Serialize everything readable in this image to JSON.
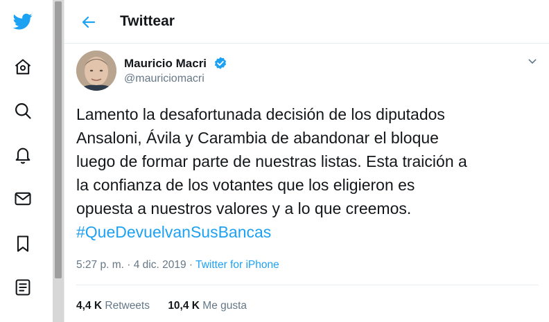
{
  "sidebar": {
    "items": [
      {
        "icon": "twitter-bird-icon"
      },
      {
        "icon": "home-icon"
      },
      {
        "icon": "search-icon"
      },
      {
        "icon": "bell-icon"
      },
      {
        "icon": "mail-icon"
      },
      {
        "icon": "bookmark-icon"
      },
      {
        "icon": "list-icon"
      }
    ]
  },
  "header": {
    "title": "Twittear",
    "back_icon": "arrow-left-icon"
  },
  "tweet": {
    "author_name": "Mauricio Macri",
    "author_handle": "@mauriciomacri",
    "verified": true,
    "text_lines": [
      "Lamento la desafortunada decisión de los diputados",
      "Ansaloni, Ávila y Carambia de abandonar el bloque",
      "luego de formar parte de nuestras listas. Esta traición a",
      "la confianza de los votantes que los eligieron es",
      "opuesta a nuestros valores y a lo que creemos."
    ],
    "hashtag": "#QueDevuelvanSusBancas",
    "time": "5:27 p. m.",
    "date": "4 dic. 2019",
    "separator": "·",
    "source": "Twitter for iPhone",
    "retweets_count": "4,4 K",
    "retweets_label": "Retweets",
    "likes_count": "10,4 K",
    "likes_label": "Me gusta"
  },
  "colors": {
    "accent": "#1da1f2",
    "text": "#14171a",
    "muted": "#657786",
    "border": "#e6ecf0"
  }
}
